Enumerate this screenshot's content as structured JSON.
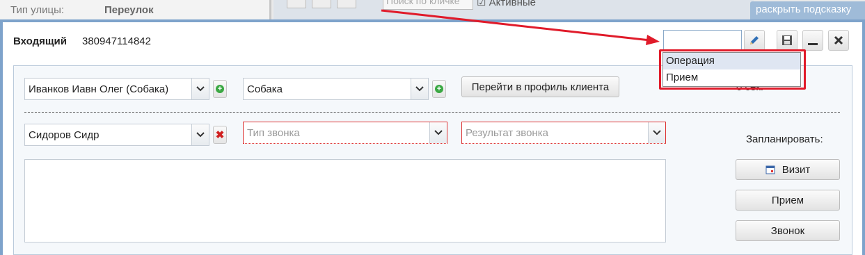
{
  "background": {
    "street_type_label": "Тип улицы:",
    "street_type_value": "Переулок",
    "search_placeholder": "Поиск по кличке",
    "active_label": "Активные",
    "hint_link": "раскрыть подсказку"
  },
  "call": {
    "direction": "Входящий",
    "phone": "380947114842"
  },
  "form": {
    "client": "Иванков Иавн Олег (Собака)",
    "pet": "Собака",
    "goto_profile_button": "Перейти в профиль клиента",
    "employee": "Сидоров Сидр",
    "call_type_placeholder": "Тип звонка",
    "call_result_placeholder": "Результат звонка",
    "timer_fragment": "0 сек."
  },
  "dropdown": {
    "options": [
      "Операция",
      "Прием"
    ],
    "highlighted": "Операция"
  },
  "schedule": {
    "label": "Запланировать:",
    "visit_button": "Визит",
    "appointment_button": "Прием",
    "call_button": "Звонок"
  },
  "colors": {
    "accent": "#7ea3cb",
    "annotation_red": "#e01b2a",
    "error_red": "#dd3333",
    "add_green": "#3aa843"
  }
}
